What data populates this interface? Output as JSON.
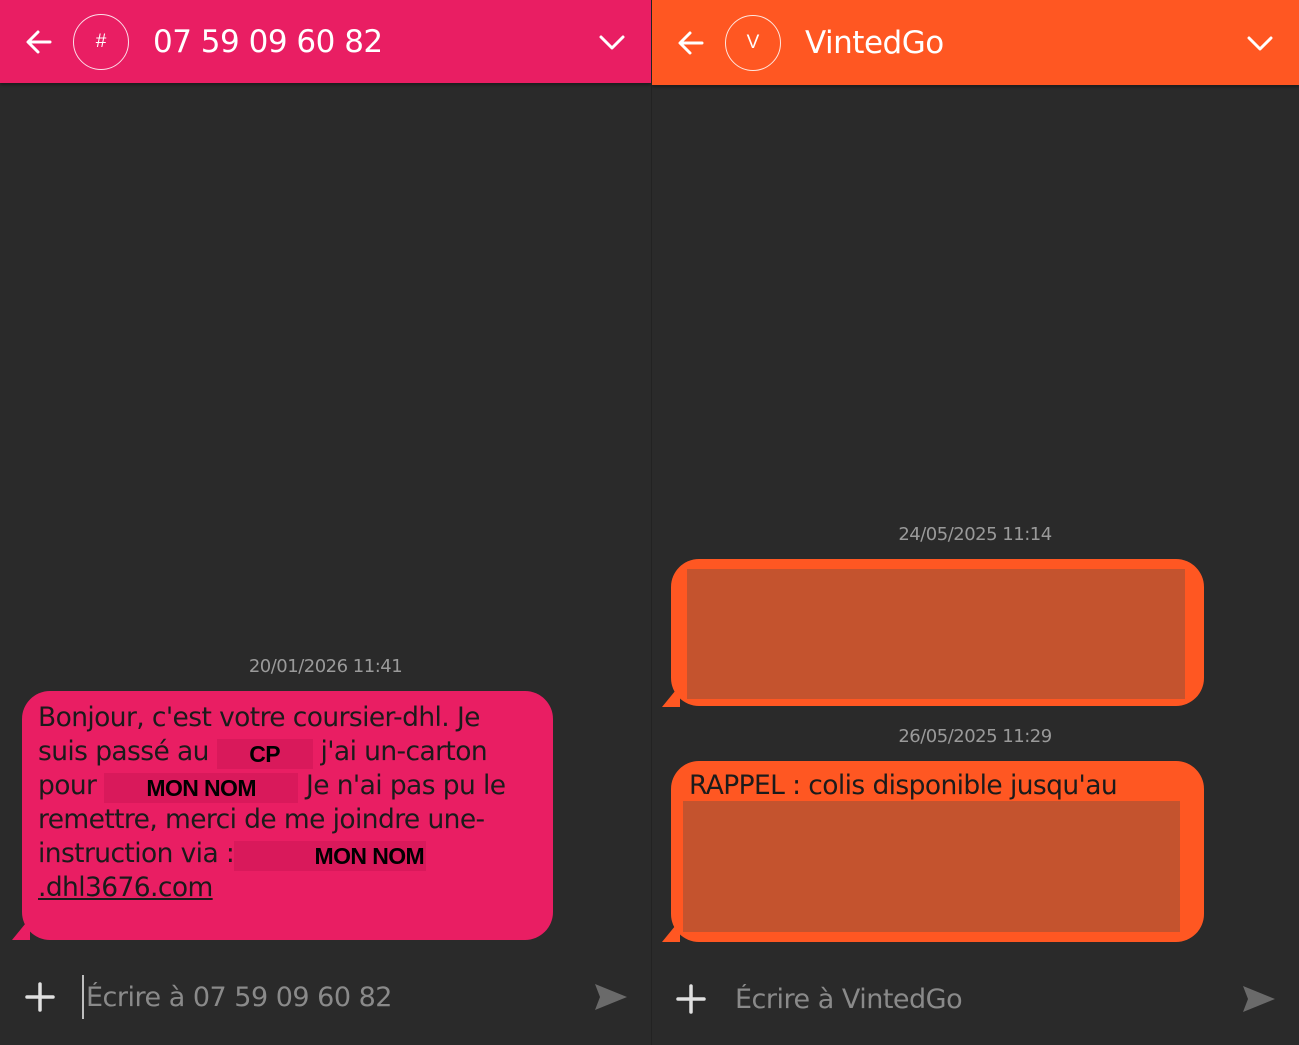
{
  "left": {
    "header": {
      "avatar_letter": "#",
      "contact": "07 59 09 60 82",
      "color": "#e91e63"
    },
    "timestamp": "20/01/2026 11:41",
    "message": {
      "part1": "Bonjour, c'est votre coursier-dhl. Je suis passé au ",
      "redact_cp": "CP",
      "part2": " j'ai un-carton pour ",
      "redact_name1": "MON NOM",
      "part3": " Je n'ai pas pu le remettre, merci de me joindre une-instruction via : ",
      "redact_name2": "MON NOM",
      "link": ".dhl3676.com"
    },
    "composer": {
      "placeholder": "Écrire à 07 59 09 60 82"
    }
  },
  "right": {
    "header": {
      "avatar_letter": "V",
      "contact": "VintedGo",
      "color": "#ff5722"
    },
    "messages": [
      {
        "timestamp": "24/05/2025 11:14",
        "text": ""
      },
      {
        "timestamp": "26/05/2025 11:29",
        "text": "RAPPEL : colis disponible jusqu'au"
      }
    ],
    "composer": {
      "placeholder": "Écrire à VintedGo"
    }
  },
  "icons": {
    "back": "arrow-left-icon",
    "dropdown": "chevron-down-icon",
    "attach": "plus-icon",
    "send": "send-icon"
  }
}
